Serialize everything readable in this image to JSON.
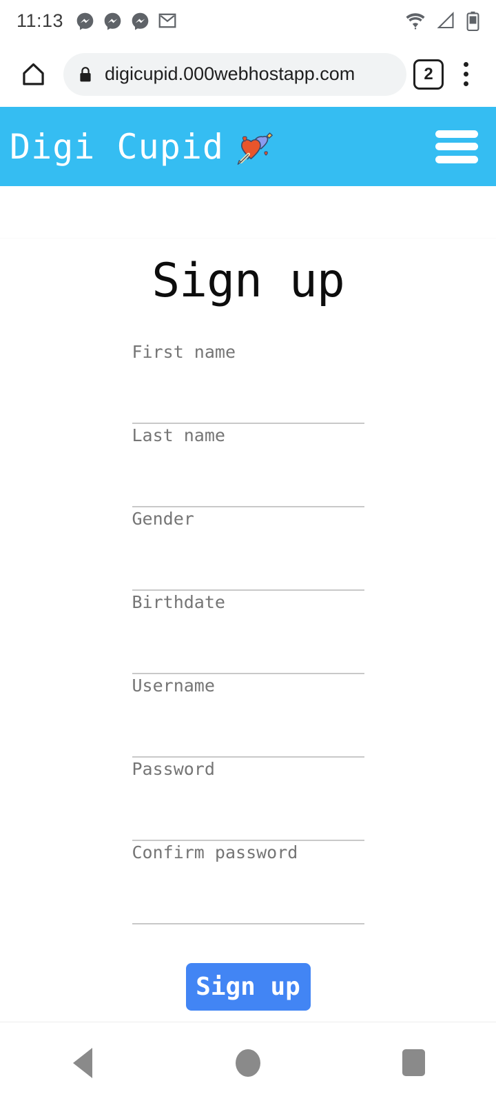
{
  "status_bar": {
    "clock": "11:13",
    "notification_icons": [
      "messenger-icon",
      "messenger-icon",
      "messenger-icon",
      "gmail-icon"
    ],
    "system_icons": [
      "wifi-icon",
      "cell-signal-icon",
      "battery-icon"
    ]
  },
  "browser": {
    "home_label": "Home",
    "url": "digicupid.000webhostapp.com",
    "lock_label": "Secure connection",
    "tab_count": "2",
    "menu_label": "More options"
  },
  "site_header": {
    "brand": "Digi Cupid",
    "brand_emoji": "heart-with-arrow",
    "menu_label": "Menu",
    "background_color": "#35bdf2"
  },
  "page": {
    "title": "Sign up",
    "fields": [
      {
        "label": "First name",
        "value": "",
        "type": "text"
      },
      {
        "label": "Last name",
        "value": "",
        "type": "text"
      },
      {
        "label": "Gender",
        "value": "",
        "type": "text"
      },
      {
        "label": "Birthdate",
        "value": "",
        "type": "text"
      },
      {
        "label": "Username",
        "value": "",
        "type": "text"
      },
      {
        "label": "Password",
        "value": "",
        "type": "password"
      },
      {
        "label": "Confirm password",
        "value": "",
        "type": "password"
      }
    ],
    "submit_label": "Sign up",
    "submit_color": "#4285f4"
  },
  "nav_bar": {
    "back_label": "Back",
    "home_label": "Home",
    "recents_label": "Recent apps"
  }
}
